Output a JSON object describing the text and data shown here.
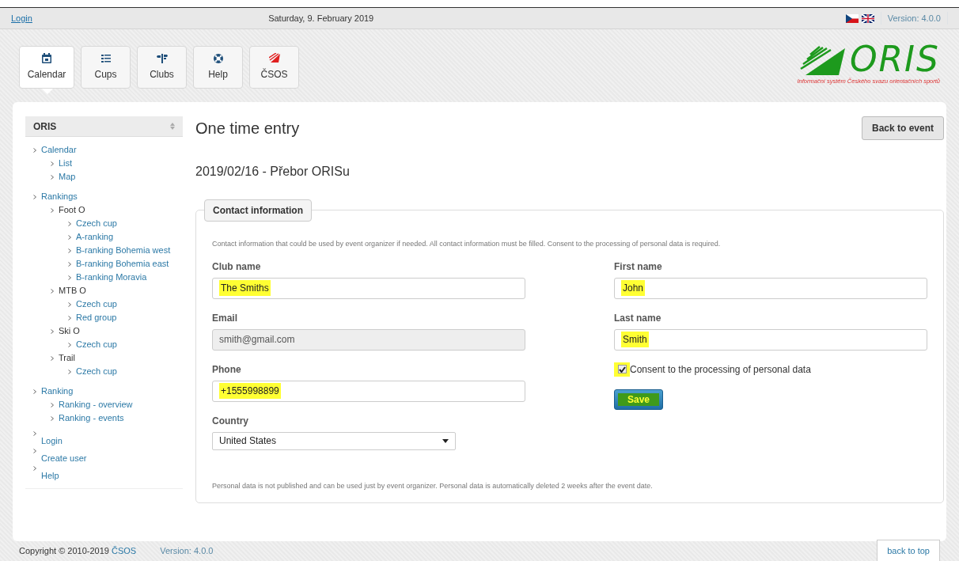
{
  "top_bar": {
    "login": "Login",
    "date": "Saturday, 9. February 2019",
    "version": "Version: 4.0.0"
  },
  "nav": [
    {
      "label": "Calendar",
      "kind": "calendar",
      "selected": true
    },
    {
      "label": "Cups",
      "kind": "list",
      "selected": false
    },
    {
      "label": "Clubs",
      "kind": "signpost",
      "selected": false
    },
    {
      "label": "Help",
      "kind": "lifebuoy",
      "selected": false
    },
    {
      "label": "ČSOS",
      "kind": "csos",
      "selected": false
    }
  ],
  "logo": {
    "name": "ORIS",
    "subtitle": "Informační systém Českého svazu orientačních sportů"
  },
  "sidebar": {
    "title": "ORIS",
    "items": [
      {
        "label": "Calendar",
        "children": [
          {
            "label": "List"
          },
          {
            "label": "Map"
          }
        ]
      },
      {
        "label": "Rankings",
        "children": [
          {
            "label": "Foot O",
            "children": [
              {
                "label": "Czech cup"
              },
              {
                "label": "A-ranking"
              },
              {
                "label": "B-ranking Bohemia west"
              },
              {
                "label": "B-ranking Bohemia east"
              },
              {
                "label": "B-ranking Moravia"
              }
            ]
          },
          {
            "label": "MTB O",
            "children": [
              {
                "label": "Czech cup"
              },
              {
                "label": "Red group"
              }
            ]
          },
          {
            "label": "Ski O",
            "children": [
              {
                "label": "Czech cup"
              }
            ]
          },
          {
            "label": "Trail",
            "children": [
              {
                "label": "Czech cup"
              }
            ]
          }
        ]
      },
      {
        "label": "Ranking",
        "children": [
          {
            "label": "Ranking - overview"
          },
          {
            "label": "Ranking - events"
          }
        ]
      }
    ],
    "links": [
      {
        "label": "Login"
      },
      {
        "label": "Create user"
      },
      {
        "label": "Help"
      }
    ]
  },
  "page": {
    "title": "One time entry",
    "back_button": "Back to event",
    "event": "2019/02/16 - Přebor ORISu"
  },
  "form": {
    "legend": "Contact information",
    "intro": "Contact information that could be used by event organizer if needed. All contact information must be filled. Consent to the processing of personal data is required.",
    "left": [
      {
        "label": "Club name",
        "kind": "text",
        "value": "The Smiths",
        "highlighted": true,
        "disabled": false
      },
      {
        "label": "Email",
        "kind": "text",
        "value": "smith@gmail.com",
        "highlighted": false,
        "disabled": true
      },
      {
        "label": "Phone",
        "kind": "text",
        "value": "+1555998899",
        "highlighted": true,
        "disabled": false
      },
      {
        "label": "Country",
        "kind": "select",
        "value": "United States",
        "highlighted": false,
        "disabled": false
      }
    ],
    "right": [
      {
        "label": "First name",
        "kind": "text",
        "value": "John",
        "highlighted": true,
        "disabled": false
      },
      {
        "label": "Last name",
        "kind": "text",
        "value": "Smith",
        "highlighted": true,
        "disabled": false
      }
    ],
    "consent": {
      "label": "Consent to the processing of personal data",
      "checked": true,
      "highlighted": true
    },
    "save": "Save",
    "note": "Personal data is not published and can be used just by event organizer. Personal data is automatically deleted 2 weeks after the event date."
  },
  "footer": {
    "copyright": "Copyright © 2010-2019",
    "link": "ČSOS",
    "version": "Version: 4.0.0",
    "back_to_top": "back to top"
  }
}
